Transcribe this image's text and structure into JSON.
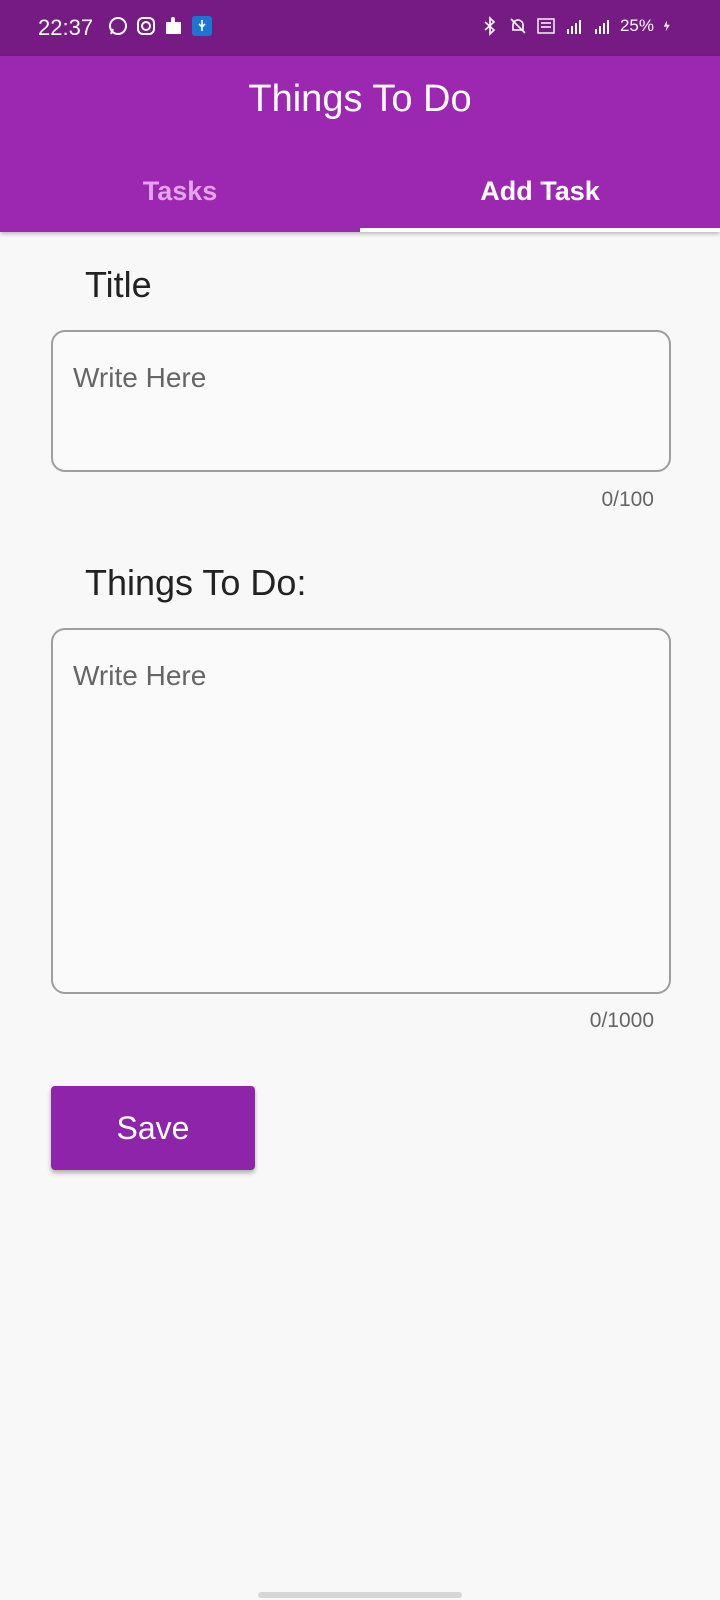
{
  "status_bar": {
    "time": "22:37",
    "left_icons": [
      "whatsapp-icon",
      "instagram-icon",
      "puzzle-icon",
      "usb-icon"
    ],
    "right_icons": [
      "bluetooth-icon",
      "mute-icon",
      "volte-icon",
      "signal-4g-icon",
      "signal-icon"
    ],
    "battery": "25%"
  },
  "app_bar": {
    "title": "Things To Do",
    "tabs": [
      {
        "label": "Tasks",
        "active": false
      },
      {
        "label": "Add Task",
        "active": true
      }
    ]
  },
  "form": {
    "title_label": "Title",
    "title_placeholder": "Write Here",
    "title_counter": "0/100",
    "todo_label": "Things To Do:",
    "todo_placeholder": "Write Here",
    "todo_counter": "0/1000",
    "save_label": "Save"
  },
  "colors": {
    "status_bar": "#761b83",
    "app_bar": "#9c27b0",
    "button": "#8e24aa",
    "inactive_tab": "#e1a5ec"
  }
}
